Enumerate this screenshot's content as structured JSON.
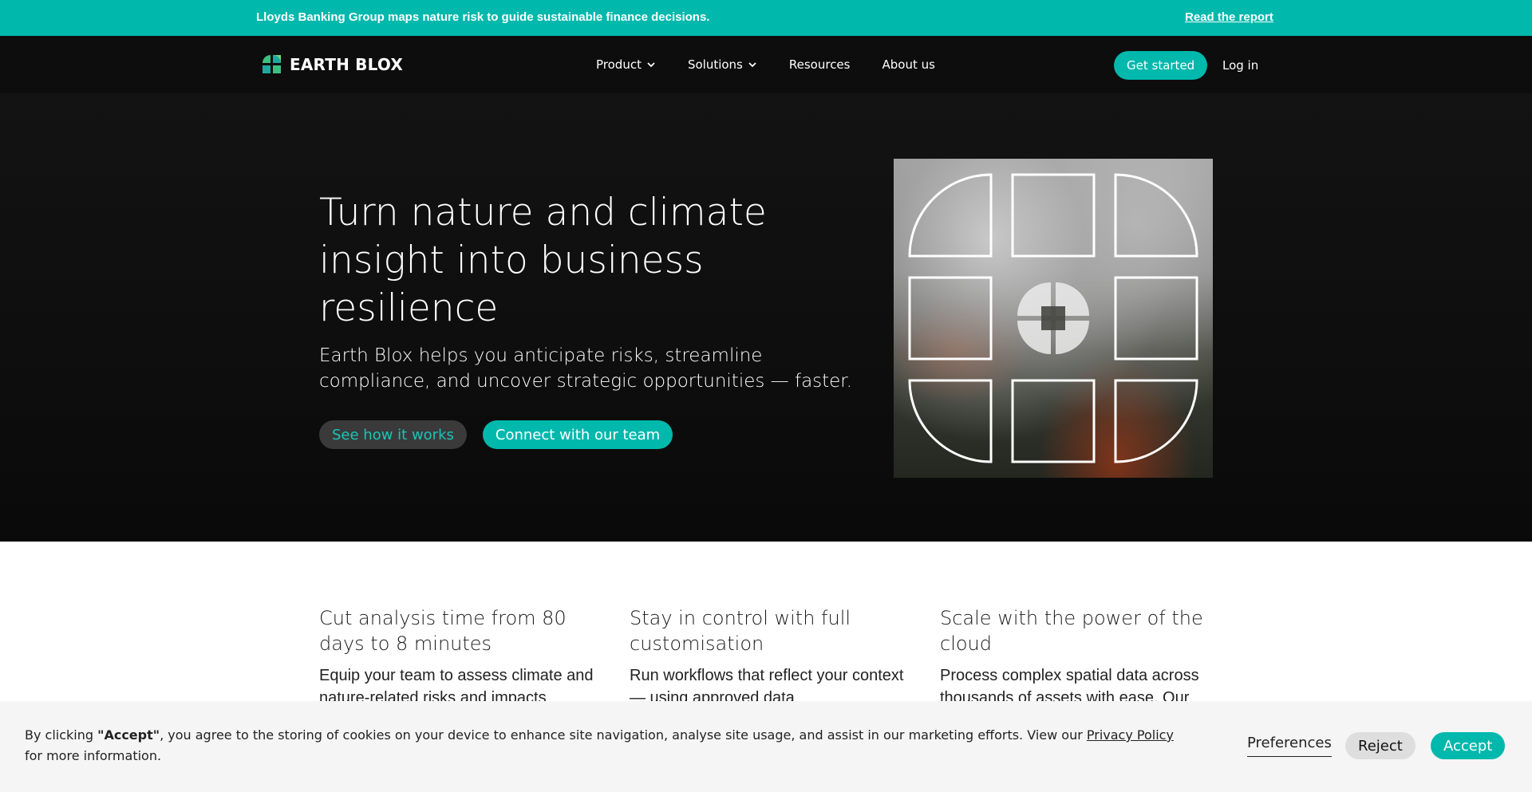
{
  "announcement": {
    "text": "Lloyds Banking Group maps nature risk to guide sustainable finance decisions.",
    "link": "Read the report"
  },
  "nav": {
    "logo_text": "EARTH BLOX",
    "items": [
      {
        "label": "Product",
        "has_dropdown": true
      },
      {
        "label": "Solutions",
        "has_dropdown": true
      },
      {
        "label": "Resources",
        "has_dropdown": false
      },
      {
        "label": "About us",
        "has_dropdown": false
      }
    ],
    "cta": "Get started",
    "login": "Log in"
  },
  "hero": {
    "title": "Turn nature and climate insight into business resilience",
    "subtitle": "Earth Blox helps you anticipate risks, streamline compliance, and uncover strategic opportunities — faster.",
    "btn_secondary": "See how it works",
    "btn_primary": "Connect with our team"
  },
  "features": [
    {
      "title": "Cut analysis time from 80 days to 8 minutes",
      "text": "Equip your team to assess climate and nature-related risks and impacts"
    },
    {
      "title": "Stay in control with full customisation",
      "text": "Run workflows that reflect your context — using approved data"
    },
    {
      "title": "Scale with the power of the cloud",
      "text": "Process complex spatial data across thousands of assets with ease. Our"
    }
  ],
  "cookie": {
    "prefix": "By clicking ",
    "accept_word": "\"Accept\"",
    "middle": ", you agree to the storing of cookies on your device to enhance site navigation, analyse site usage, and assist in our marketing efforts. View our ",
    "privacy_link": "Privacy Policy",
    "suffix": " for more information.",
    "preferences": "Preferences",
    "reject": "Reject",
    "accept": "Accept"
  },
  "colors": {
    "accent": "#00b8ac",
    "dark_bg": "#0d0d0d"
  }
}
